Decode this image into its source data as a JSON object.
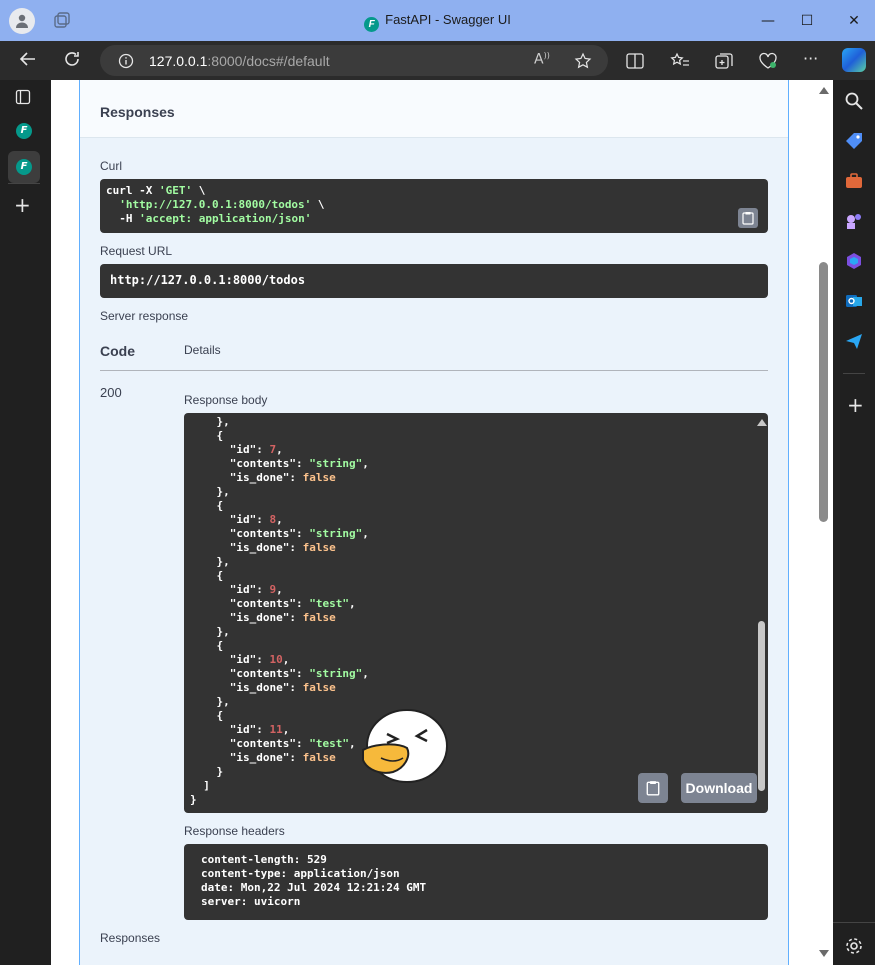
{
  "window": {
    "title": "FastAPI - Swagger UI",
    "minimize": "—",
    "maximize": "☐",
    "close": "✕"
  },
  "address": {
    "host": "127.0.0.1",
    "rest": ":8000/docs#/default"
  },
  "responses_section": {
    "header": "Responses",
    "curl_label": "Curl",
    "curl_lines": [
      "curl -X 'GET' \\",
      "  'http://127.0.0.1:8000/todos' \\",
      "  -H 'accept: application/json'"
    ],
    "request_url_label": "Request URL",
    "request_url": "http://127.0.0.1:8000/todos",
    "server_response_label": "Server response",
    "code_header": "Code",
    "details_header": "Details",
    "code": "200",
    "response_body_label": "Response body",
    "download_label": "Download",
    "response_headers_label": "Response headers",
    "headers": [
      "content-length: 529",
      "content-type: application/json",
      "date: Mon,22 Jul 2024 12:21:24 GMT",
      "server: uvicorn"
    ],
    "footer_label": "Responses"
  },
  "response_body": [
    {
      "id": 7,
      "contents": "string",
      "is_done": "false"
    },
    {
      "id": 8,
      "contents": "string",
      "is_done": "false"
    },
    {
      "id": 9,
      "contents": "test",
      "is_done": "false"
    },
    {
      "id": 10,
      "contents": "string",
      "is_done": "false"
    },
    {
      "id": 11,
      "contents": "test",
      "is_done": "false"
    }
  ],
  "colors": {
    "accent": "#61affe",
    "code_bg": "#333333",
    "string": "#a2fca2",
    "number": "#d36363",
    "keyword": "#fcc28c",
    "titlebar": "#8fb0f0"
  }
}
